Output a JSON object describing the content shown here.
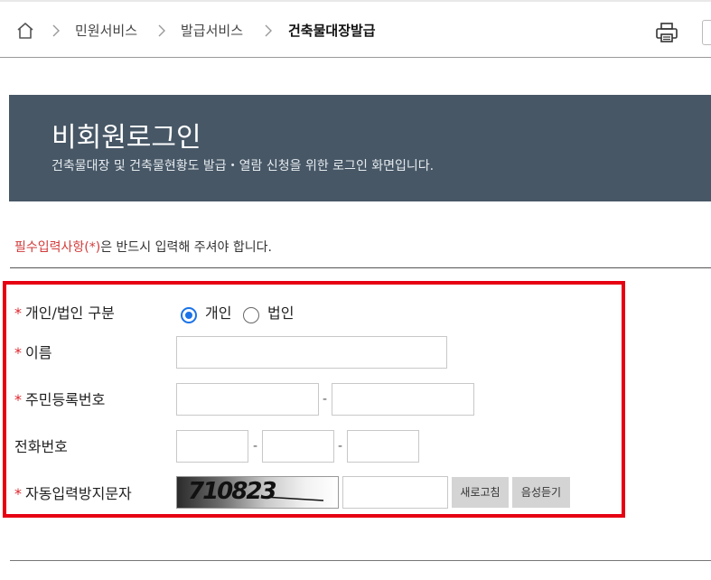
{
  "breadcrumb": {
    "items": [
      "민원서비스",
      "발급서비스"
    ],
    "current": "건축물대장발급"
  },
  "banner": {
    "title": "비회원로그인",
    "subtitle": "건축물대장 및 건축물현황도 발급・열람 신청을 위한 로그인 화면입니다."
  },
  "notice": {
    "required_mark": "필수입력사항(*)",
    "rest": "은 반드시 입력해 주셔야 합니다."
  },
  "form": {
    "required_symbol": "*",
    "type_label": "개인/법인 구분",
    "type_options": [
      "개인",
      "법인"
    ],
    "type_selected": "개인",
    "name_label": "이름",
    "name_value": "",
    "resident_label": "주민등록번호",
    "resident_values": [
      "",
      ""
    ],
    "phone_label": "전화번호",
    "phone_values": [
      "",
      "",
      ""
    ],
    "dash": "-",
    "captcha_label": "자동입력방지문자",
    "captcha_text": "710823",
    "captcha_value": "",
    "refresh_button": "새로고침",
    "audio_button": "음성듣기"
  },
  "colors": {
    "banner_bg": "#475766",
    "required": "#e0242b",
    "highlight_border": "#e60012",
    "radio_active": "#1a73e8"
  }
}
